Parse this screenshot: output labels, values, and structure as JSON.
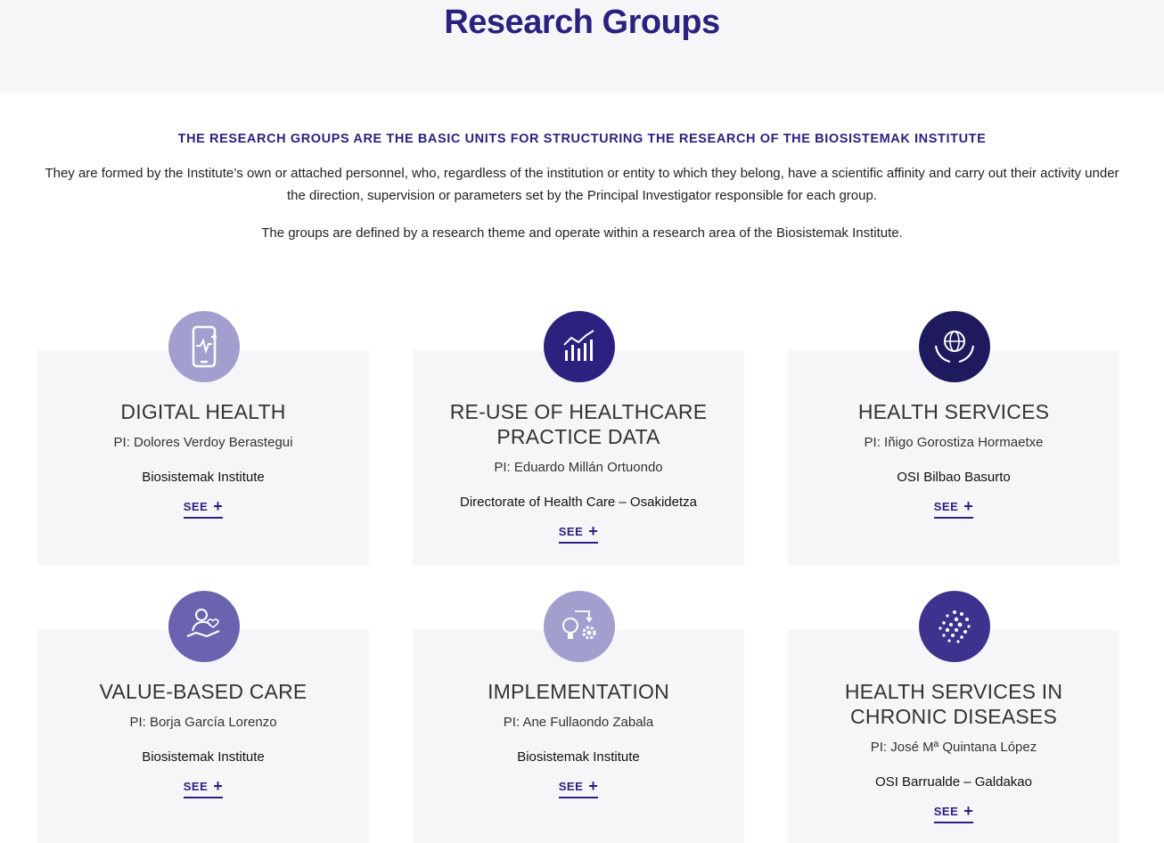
{
  "hero": {
    "title": "Research Groups"
  },
  "intro": {
    "kicker": "THE RESEARCH GROUPS ARE THE BASIC UNITS FOR STRUCTURING THE RESEARCH OF THE BIOSISTEMAK INSTITUTE",
    "paragraph1": "They are formed by the Institute’s own or attached personnel, who, regardless of the institution or entity to which they belong, have a scientific affinity and carry out their activity under the direction, supervision or parameters set by the Principal Investigator responsible for each group.",
    "paragraph2": "The groups are defined by a research theme and operate within a research area of the Biosistemak Institute."
  },
  "groups": [
    {
      "title": "DIGITAL HEALTH",
      "pi": "PI: Dolores Verdoy Berastegui",
      "institution": "Biosistemak Institute",
      "see_label": "SEE",
      "icon": "smartphone-health-icon",
      "color": "#a29fcf"
    },
    {
      "title": "RE-USE OF HEALTHCARE PRACTICE DATA",
      "pi": "PI: Eduardo Millán Ortuondo",
      "institution": "Directorate of Health Care – Osakidetza",
      "see_label": "SEE",
      "icon": "bar-chart-icon",
      "color": "#2b2280"
    },
    {
      "title": "HEALTH SERVICES",
      "pi": "PI: Iñigo Gorostiza Hormaetxe",
      "institution": "OSI Bilbao Basurto",
      "see_label": "SEE",
      "icon": "globe-hands-icon",
      "color": "#1e1a5e"
    },
    {
      "title": "VALUE-BASED CARE",
      "pi": "PI: Borja García Lorenzo",
      "institution": "Biosistemak Institute",
      "see_label": "SEE",
      "icon": "care-person-icon",
      "color": "#6a63b0"
    },
    {
      "title": "IMPLEMENTATION",
      "pi": "PI: Ane Fullaondo Zabala",
      "institution": "Biosistemak Institute",
      "see_label": "SEE",
      "icon": "idea-gear-icon",
      "color": "#a29fcf"
    },
    {
      "title": "HEALTH SERVICES IN CHRONIC DISEASES",
      "pi": "PI: José Mª Quintana López",
      "institution": "OSI Barrualde – Galdakao",
      "see_label": "SEE",
      "icon": "network-dots-icon",
      "color": "#3d338f"
    }
  ]
}
